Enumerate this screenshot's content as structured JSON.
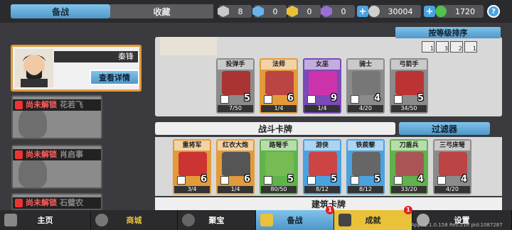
{
  "tabs": {
    "active": "备战",
    "inactive": "收藏"
  },
  "resources": [
    {
      "icon": "silver-gem-icon",
      "color": "#c9c9c9",
      "value": "8"
    },
    {
      "icon": "blue-gem-icon",
      "color": "#6bb3e8",
      "value": "0"
    },
    {
      "icon": "gold-gem-icon",
      "color": "#e9c23a",
      "value": "0"
    },
    {
      "icon": "purple-gem-icon",
      "color": "#9a6fd6",
      "value": "0"
    }
  ],
  "currency": {
    "coins": "30004",
    "gems": "1720",
    "help": "?"
  },
  "hero": {
    "name": "秦锋",
    "detail_button": "查看详情"
  },
  "locked_heroes": [
    {
      "label": "尚未解锁",
      "ghost_name": "花若飞"
    },
    {
      "label": "尚未解锁",
      "ghost_name": "肖启事"
    },
    {
      "label": "尚未解锁",
      "ghost_name": "石璧农"
    }
  ],
  "sort_button": "按等级排序",
  "filter_small": [
    "1",
    "3",
    "2",
    "1"
  ],
  "equipped_cards": [
    {
      "name": "投弹手",
      "cost": "5",
      "progress": "7/50",
      "frame": "#8b8b8b",
      "art": "#a33"
    },
    {
      "name": "法师",
      "cost": "6",
      "progress": "1/4",
      "frame": "#e39b3a",
      "art": "#b44"
    },
    {
      "name": "女巫",
      "cost": "9",
      "progress": "1/4",
      "frame": "#7a4ab8",
      "art": "#c3a"
    },
    {
      "name": "骑士",
      "cost": "4",
      "progress": "4/20",
      "frame": "#8b8b8b",
      "art": "#777"
    },
    {
      "name": "弓箭手",
      "cost": "5",
      "progress": "34/50",
      "frame": "#8b8b8b",
      "art": "#b33"
    }
  ],
  "section_battle": "战斗卡牌",
  "filter_button": "过滤器",
  "battle_cards": [
    {
      "name": "重将军",
      "cost": "6",
      "progress": "3/4",
      "frame": "#e39b3a",
      "art": "#c33"
    },
    {
      "name": "红衣大炮",
      "cost": "6",
      "progress": "1/4",
      "frame": "#e39b3a",
      "art": "#555"
    },
    {
      "name": "路弩手",
      "cost": "5",
      "progress": "80/50",
      "frame": "#5fb34a",
      "art": "#7b5"
    },
    {
      "name": "游侠",
      "cost": "5",
      "progress": "8/12",
      "frame": "#4aa3e0",
      "art": "#c44"
    },
    {
      "name": "铁蒺藜",
      "cost": "5",
      "progress": "8/12",
      "frame": "#4aa3e0",
      "art": "#666"
    },
    {
      "name": "刀盾兵",
      "cost": "4",
      "progress": "33/20",
      "frame": "#5fb34a",
      "art": "#a55"
    },
    {
      "name": "三弓床弩",
      "cost": "4",
      "progress": "4/20",
      "frame": "#8b8b8b",
      "art": "#b44"
    }
  ],
  "section_building": "建筑卡牌",
  "nav": [
    {
      "label": "主页",
      "badge": ""
    },
    {
      "label": "商城",
      "badge": ""
    },
    {
      "label": "聚宝",
      "badge": ""
    },
    {
      "label": "备战",
      "badge": "1"
    },
    {
      "label": "成就",
      "badge": "1"
    },
    {
      "label": "设置",
      "badge": ""
    }
  ],
  "footnote": "App: 1.1.0.158 Res:216 pid:1087287"
}
